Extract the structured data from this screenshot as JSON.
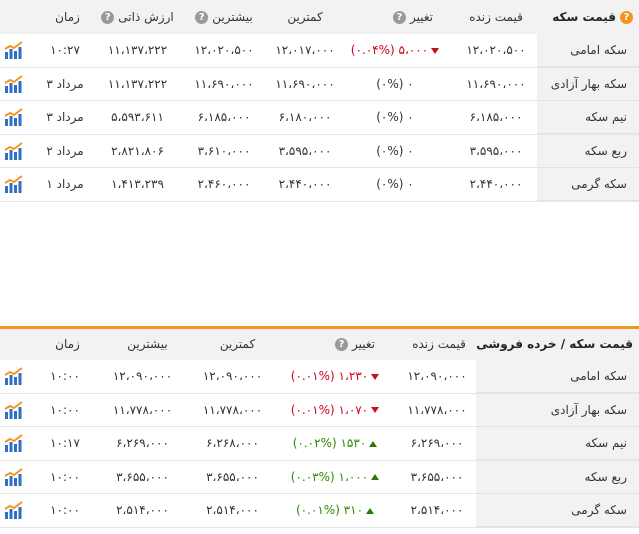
{
  "colors": {
    "accent": "#f7941d",
    "negative": "#d0021b",
    "positive": "#2d8a00",
    "header_bg": "#f2f2f2"
  },
  "coin_prices": {
    "title": "قیمت سکه",
    "columns": {
      "live": "قیمت زنده",
      "change": "تغییر",
      "min": "کمترین",
      "max": "بیشترین",
      "intrinsic": "ارزش ذاتی",
      "time": "زمان"
    },
    "rows": [
      {
        "name": "سکه امامی",
        "live": "۱۲،۰۲۰،۵۰۰",
        "change": "(۰.۰۴%) ۵،۰۰۰",
        "trend": "down",
        "min": "۱۲،۰۱۷،۰۰۰",
        "max": "۱۲،۰۲۰،۵۰۰",
        "intrinsic": "۱۱،۱۳۷،۲۲۲",
        "time": "۱۰:۲۷",
        "icon": "chart-icon"
      },
      {
        "name": "سکه بهار آزادی",
        "live": "۱۱،۶۹۰،۰۰۰",
        "change": "(۰%) ۰",
        "trend": "none",
        "min": "۱۱،۶۹۰،۰۰۰",
        "max": "۱۱،۶۹۰،۰۰۰",
        "intrinsic": "۱۱،۱۳۷،۲۲۲",
        "time": "۳ مرداد",
        "icon": "chart-icon"
      },
      {
        "name": "نیم سکه",
        "live": "۶،۱۸۵،۰۰۰",
        "change": "(۰%) ۰",
        "trend": "none",
        "min": "۶،۱۸۰،۰۰۰",
        "max": "۶،۱۸۵،۰۰۰",
        "intrinsic": "۵،۵۹۳،۶۱۱",
        "time": "۳ مرداد",
        "icon": "chart-icon"
      },
      {
        "name": "ربع سکه",
        "live": "۳،۵۹۵،۰۰۰",
        "change": "(۰%) ۰",
        "trend": "none",
        "min": "۳،۵۹۵،۰۰۰",
        "max": "۳،۶۱۰،۰۰۰",
        "intrinsic": "۲،۸۲۱،۸۰۶",
        "time": "۲ مرداد",
        "icon": "chart-icon"
      },
      {
        "name": "سکه گرمی",
        "live": "۲،۴۴۰،۰۰۰",
        "change": "(۰%) ۰",
        "trend": "none",
        "min": "۲،۴۴۰،۰۰۰",
        "max": "۲،۴۶۰،۰۰۰",
        "intrinsic": "۱،۴۱۳،۲۳۹",
        "time": "۱ مرداد",
        "icon": "chart-icon"
      }
    ]
  },
  "retail_prices": {
    "title": "قیمت سکه / خرده فروشی",
    "columns": {
      "live": "قیمت زنده",
      "change": "تغییر",
      "min": "کمترین",
      "max": "بیشترین",
      "time": "زمان"
    },
    "rows": [
      {
        "name": "سکه امامی",
        "live": "۱۲،۰۹۰،۰۰۰",
        "change": "(۰.۰۱%) ۱،۲۳۰",
        "trend": "down",
        "min": "۱۲،۰۹۰،۰۰۰",
        "max": "۱۲،۰۹۰،۰۰۰",
        "time": "۱۰:۰۰",
        "icon": "chart-icon"
      },
      {
        "name": "سکه بهار آزادی",
        "live": "۱۱،۷۷۸،۰۰۰",
        "change": "(۰.۰۱%) ۱،۰۷۰",
        "trend": "down",
        "min": "۱۱،۷۷۸،۰۰۰",
        "max": "۱۱،۷۷۸،۰۰۰",
        "time": "۱۰:۰۰",
        "icon": "chart-icon"
      },
      {
        "name": "نیم سکه",
        "live": "۶،۲۶۹،۰۰۰",
        "change": "(۰.۰۲%) ۱۵۳۰",
        "trend": "up",
        "min": "۶،۲۶۸،۰۰۰",
        "max": "۶،۲۶۹،۰۰۰",
        "time": "۱۰:۱۷",
        "icon": "chart-icon"
      },
      {
        "name": "ربع سکه",
        "live": "۳،۶۵۵،۰۰۰",
        "change": "(۰.۰۳%) ۱،۰۰۰",
        "trend": "up",
        "min": "۳،۶۵۵،۰۰۰",
        "max": "۳،۶۵۵،۰۰۰",
        "time": "۱۰:۰۰",
        "icon": "chart-icon"
      },
      {
        "name": "سکه گرمی",
        "live": "۲،۵۱۴،۰۰۰",
        "change": "(۰.۰۱%) ۳۱۰",
        "trend": "up",
        "min": "۲،۵۱۴،۰۰۰",
        "max": "۲،۵۱۴،۰۰۰",
        "time": "۱۰:۰۰",
        "icon": "chart-icon"
      }
    ]
  }
}
